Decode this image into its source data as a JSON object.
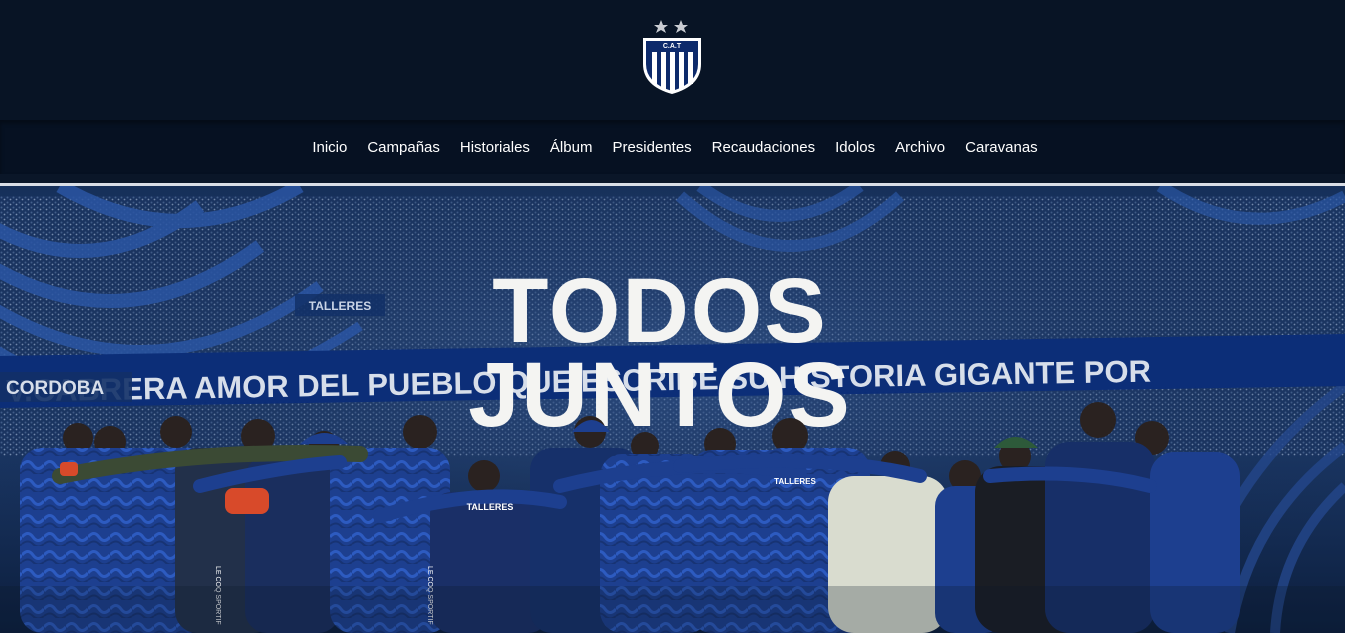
{
  "logo": {
    "icon": "club-crest-icon",
    "text": "C.A.T"
  },
  "nav": {
    "items": [
      {
        "label": "Inicio"
      },
      {
        "label": "Campañas"
      },
      {
        "label": "Historiales"
      },
      {
        "label": "Álbum"
      },
      {
        "label": "Presidentes"
      },
      {
        "label": "Recaudaciones"
      },
      {
        "label": "Idolos"
      },
      {
        "label": "Archivo"
      },
      {
        "label": "Caravanas"
      }
    ]
  },
  "hero": {
    "headline_line1": "TODOS",
    "headline_line2": "JUNTOS",
    "banner_text": "V.CABRERA AMOR DEL PUEBLO QUE ESCRIBE SU HISTORIA GIGANTE POR",
    "sign_left": "CORDOBA",
    "sign_top": "TALLERES",
    "shirt_text_1": "TALLERES",
    "shirt_text_2": "TALLERES",
    "sponsor_1": "LE COQ SPORTIF",
    "sponsor_2": "LE COQ SPORTIF"
  },
  "colors": {
    "header_bg": "#081425",
    "nav_bg": "#061122",
    "brand_blue": "#1c3f8a",
    "headline_white": "#f4f4f2"
  }
}
